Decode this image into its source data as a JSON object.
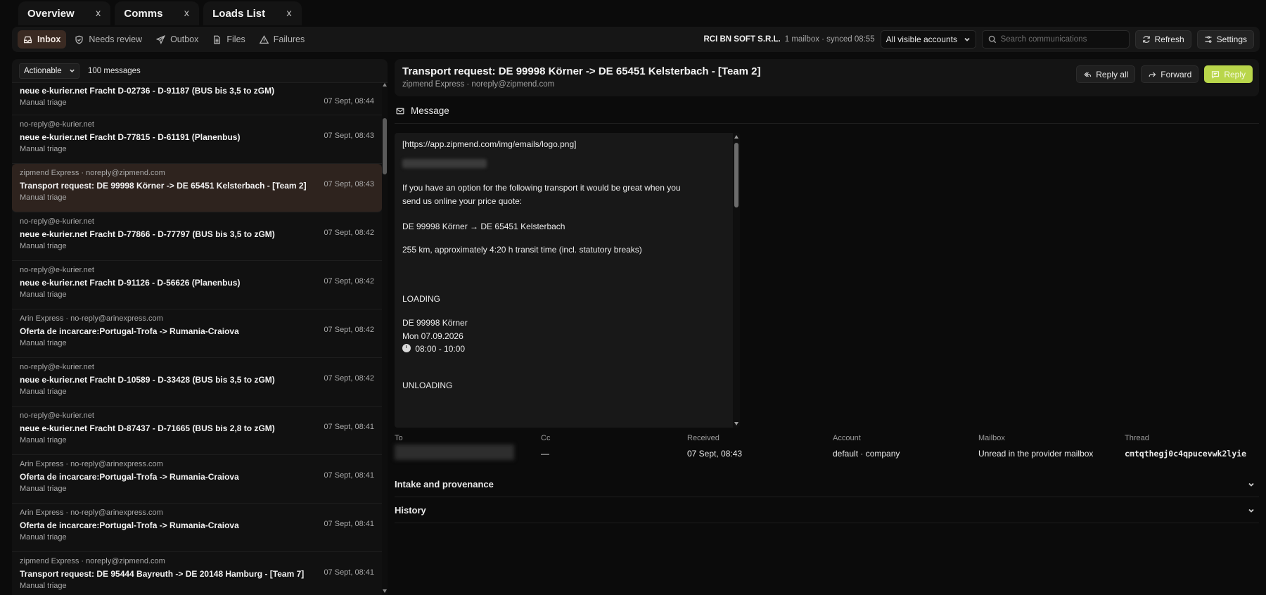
{
  "tabs": [
    {
      "label": "Overview",
      "close": "x"
    },
    {
      "label": "Comms",
      "close": "x"
    },
    {
      "label": "Loads List",
      "close": "x"
    }
  ],
  "toolbar": {
    "nav": [
      {
        "label": "Inbox",
        "icon": "inbox-icon",
        "active": true
      },
      {
        "label": "Needs review",
        "icon": "shield-icon"
      },
      {
        "label": "Outbox",
        "icon": "send-icon"
      },
      {
        "label": "Files",
        "icon": "file-icon"
      },
      {
        "label": "Failures",
        "icon": "warning-icon"
      }
    ],
    "org": "RCI BN SOFT S.R.L.",
    "sync_status": "1 mailbox · synced 08:55",
    "account_select": "All visible accounts",
    "search_placeholder": "Search communications",
    "refresh_label": "Refresh",
    "settings_label": "Settings"
  },
  "list": {
    "filter": "Actionable",
    "count": "100 messages",
    "items": [
      {
        "from": "",
        "subject": "neue e-kurier.net Fracht D-02736 - D-91187 (BUS bis 3,5 to zGM)",
        "status": "Manual triage",
        "time": "07 Sept, 08:44"
      },
      {
        "from": "no-reply@e-kurier.net",
        "subject": "neue e-kurier.net Fracht D-77815 - D-61191 (Planenbus)",
        "status": "Manual triage",
        "time": "07 Sept, 08:43"
      },
      {
        "from": "zipmend Express · noreply@zipmend.com",
        "subject": "Transport request: DE 99998 Körner -> DE 65451 Kelsterbach - [Team 2]",
        "status": "Manual triage",
        "time": "07 Sept, 08:43"
      },
      {
        "from": "no-reply@e-kurier.net",
        "subject": "neue e-kurier.net Fracht D-77866 - D-77797 (BUS bis 3,5 to zGM)",
        "status": "Manual triage",
        "time": "07 Sept, 08:42"
      },
      {
        "from": "no-reply@e-kurier.net",
        "subject": "neue e-kurier.net Fracht D-91126 - D-56626 (Planenbus)",
        "status": "Manual triage",
        "time": "07 Sept, 08:42"
      },
      {
        "from": "Arin Express · no-reply@arinexpress.com",
        "subject": "Oferta de incarcare:Portugal-Trofa -> Rumania-Craiova",
        "status": "Manual triage",
        "time": "07 Sept, 08:42"
      },
      {
        "from": "no-reply@e-kurier.net",
        "subject": "neue e-kurier.net Fracht D-10589 - D-33428 (BUS bis 3,5 to zGM)",
        "status": "Manual triage",
        "time": "07 Sept, 08:42"
      },
      {
        "from": "no-reply@e-kurier.net",
        "subject": "neue e-kurier.net Fracht D-87437 - D-71665 (BUS bis 2,8 to zGM)",
        "status": "Manual triage",
        "time": "07 Sept, 08:41"
      },
      {
        "from": "Arin Express · no-reply@arinexpress.com",
        "subject": "Oferta de incarcare:Portugal-Trofa -> Rumania-Craiova",
        "status": "Manual triage",
        "time": "07 Sept, 08:41"
      },
      {
        "from": "Arin Express · no-reply@arinexpress.com",
        "subject": "Oferta de incarcare:Portugal-Trofa -> Rumania-Craiova",
        "status": "Manual triage",
        "time": "07 Sept, 08:41"
      },
      {
        "from": "zipmend Express · noreply@zipmend.com",
        "subject": "Transport request: DE 95444 Bayreuth -> DE 20148 Hamburg - [Team 7]",
        "status": "Manual triage",
        "time": "07 Sept, 08:41"
      }
    ]
  },
  "detail": {
    "title": "Transport request: DE 99998 Körner -> DE 65451 Kelsterbach - [Team 2]",
    "sender": "zipmend Express · noreply@zipmend.com",
    "reply_all_label": "Reply all",
    "forward_label": "Forward",
    "reply_label": "Reply",
    "section_label": "Message",
    "body": {
      "logo_line": "[https://app.zipmend.com/img/emails/logo.png]",
      "intro": "If you have an option for the following transport it would be great when you\nsend us online your price quote:",
      "route": "DE 99998 Körner → DE 65451 Kelsterbach",
      "distance": "255 km, approximately 4:20 h transit time (incl. statutory breaks)",
      "loading_heading": "LOADING",
      "loading_place": "DE 99998 Körner",
      "loading_date": "Mon 07.09.2026",
      "loading_time": "08:00 - 10:00",
      "unloading_heading": "UNLOADING"
    },
    "meta": {
      "to_label": "To",
      "cc_label": "Cc",
      "cc_value": "—",
      "received_label": "Received",
      "received_value": "07 Sept, 08:43",
      "account_label": "Account",
      "account_value": "default · company",
      "mailbox_label": "Mailbox",
      "mailbox_value": "Unread in the provider mailbox",
      "thread_label": "Thread",
      "thread_value": "cmtqthegj0c4qpucevwk2lyie"
    },
    "intake_label": "Intake and provenance",
    "history_label": "History"
  },
  "colors": {
    "accent_reply": "#b9d64b",
    "selected_row": "#2e231e",
    "active_nav": "#3a2a22"
  }
}
